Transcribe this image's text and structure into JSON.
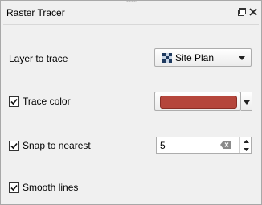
{
  "panel": {
    "title": "Raster Tracer"
  },
  "layer_row": {
    "label": "Layer to trace",
    "selected_layer": "Site Plan",
    "layer_icon": "raster-layer-icon"
  },
  "trace_color_row": {
    "label": "Trace color",
    "checked": true,
    "color": "#b5463c"
  },
  "snap_row": {
    "label": "Snap to nearest",
    "checked": true,
    "value": "5"
  },
  "smooth_row": {
    "label": "Smooth lines",
    "checked": true
  },
  "icons": {
    "float": "float-window-icon",
    "close": "close-icon",
    "clear": "clear-field-icon",
    "dropdown": "chevron-down-icon"
  }
}
